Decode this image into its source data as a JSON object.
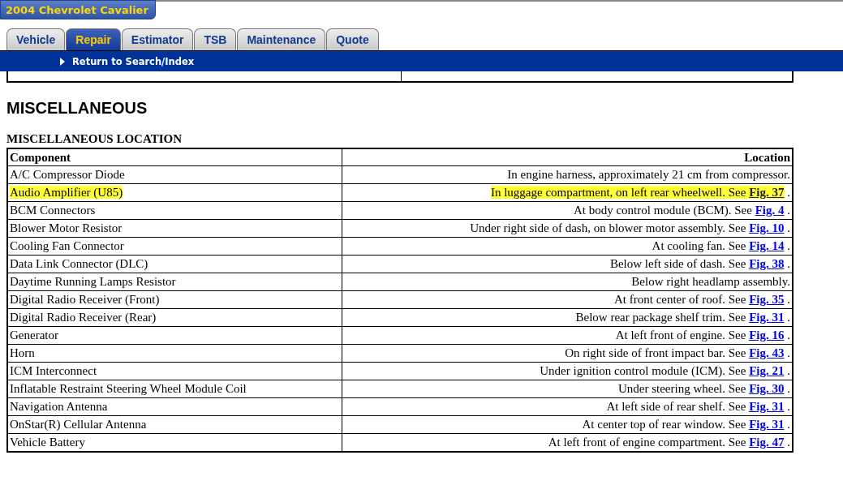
{
  "vehicle_title": "2004 Chevrolet Cavalier",
  "tabs": [
    {
      "label": "Vehicle",
      "selected": false
    },
    {
      "label": "Repair",
      "selected": true
    },
    {
      "label": "Estimator",
      "selected": false
    },
    {
      "label": "TSB",
      "selected": false
    },
    {
      "label": "Maintenance",
      "selected": false
    },
    {
      "label": "Quote",
      "selected": false
    }
  ],
  "nav_link": "Return to Search/Index",
  "section_heading": "MISCELLANEOUS",
  "table": {
    "title": "MISCELLANEOUS LOCATION",
    "columns": [
      "Component",
      "Location"
    ],
    "rows": [
      {
        "component": "A/C Compressor Diode",
        "location": "In engine harness, approximately 21 cm from compressor.",
        "highlighted": false
      },
      {
        "component": "Audio Amplifier (U85)",
        "location": "In luggage compartment, on left rear wheelwell. See",
        "figure": "Fig. 37",
        "tail": ".",
        "highlighted": true
      },
      {
        "component": "BCM Connectors",
        "location": "At body control module (BCM). See",
        "figure": "Fig. 4",
        "tail": ".",
        "highlighted": false
      },
      {
        "component": "Blower Motor Resistor",
        "location": "Under right side of dash, on blower motor assembly. See",
        "figure": "Fig. 10",
        "tail": ".",
        "highlighted": false
      },
      {
        "component": "Cooling Fan Connector",
        "location": "At cooling fan. See",
        "figure": "Fig. 14",
        "tail": ".",
        "highlighted": false
      },
      {
        "component": "Data Link Connector (DLC)",
        "location": "Below left side of dash. See",
        "figure": "Fig. 38",
        "tail": ".",
        "highlighted": false
      },
      {
        "component": "Daytime Running Lamps Resistor",
        "location": "Below right headlamp assembly.",
        "highlighted": false
      },
      {
        "component": "Digital Radio Receiver (Front)",
        "location": "At front center of roof. See",
        "figure": "Fig. 35",
        "tail": ".",
        "highlighted": false
      },
      {
        "component": "Digital Radio Receiver (Rear)",
        "location": "Below rear package shelf trim. See",
        "figure": "Fig. 31",
        "tail": ".",
        "highlighted": false
      },
      {
        "component": "Generator",
        "location": "At left front of engine. See",
        "figure": "Fig. 16",
        "tail": ".",
        "highlighted": false
      },
      {
        "component": "Horn",
        "location": "On right side of front impact bar. See",
        "figure": "Fig. 43",
        "tail": ".",
        "highlighted": false
      },
      {
        "component": "ICM Interconnect",
        "location": "Under ignition control module (ICM). See",
        "figure": "Fig. 21",
        "tail": ".",
        "highlighted": false
      },
      {
        "component": "Inflatable Restraint Steering Wheel Module Coil",
        "location": "Under steering wheel. See",
        "figure": "Fig. 30",
        "tail": ".",
        "highlighted": false
      },
      {
        "component": "Navigation Antenna",
        "location": "At left side of rear shelf. See",
        "figure": "Fig. 31",
        "tail": ".",
        "highlighted": false
      },
      {
        "component": "OnStar(R) Cellular Antenna",
        "location": "At center top of rear window. See",
        "figure": "Fig. 31",
        "tail": ".",
        "highlighted": false
      },
      {
        "component": "Vehicle Battery",
        "location": "At left front of engine compartment. See",
        "figure": "Fig. 47",
        "tail": ".",
        "highlighted": false
      }
    ]
  }
}
